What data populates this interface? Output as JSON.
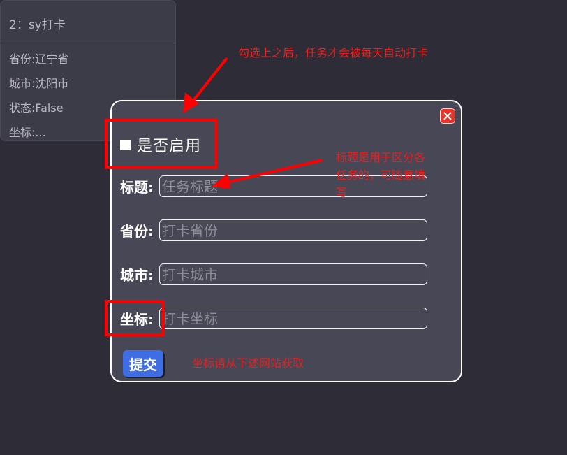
{
  "task_card": {
    "title": "2：sy打卡",
    "province": "省份:辽宁省",
    "city": "城市:沈阳市",
    "status": "状态:False",
    "coords": "坐标:..."
  },
  "modal": {
    "enable_label": "是否启用",
    "enabled": false,
    "fields": {
      "title": {
        "label": "标题:",
        "placeholder": "任务标题",
        "value": ""
      },
      "province": {
        "label": "省份:",
        "placeholder": "打卡省份",
        "value": ""
      },
      "city": {
        "label": "城市:",
        "placeholder": "打卡城市",
        "value": ""
      },
      "coords": {
        "label": "坐标:",
        "placeholder": "打卡坐标",
        "value": ""
      }
    },
    "submit_label": "提交",
    "close_icon": "close-icon"
  },
  "annotations": {
    "note_enable": "勾选上之后，任务才会被每天自动打卡",
    "note_title_line1": "标题是用于区分各",
    "note_title_line2": "任务的，可随意填",
    "note_title_line3": "写",
    "note_coords": "坐标请从下述网站获取",
    "color": "#ff0000"
  },
  "colors": {
    "background": "#2e2c36",
    "modal_bg": "#484756",
    "submit_bg": "#3e6de4",
    "close_bg": "#e5352b"
  }
}
